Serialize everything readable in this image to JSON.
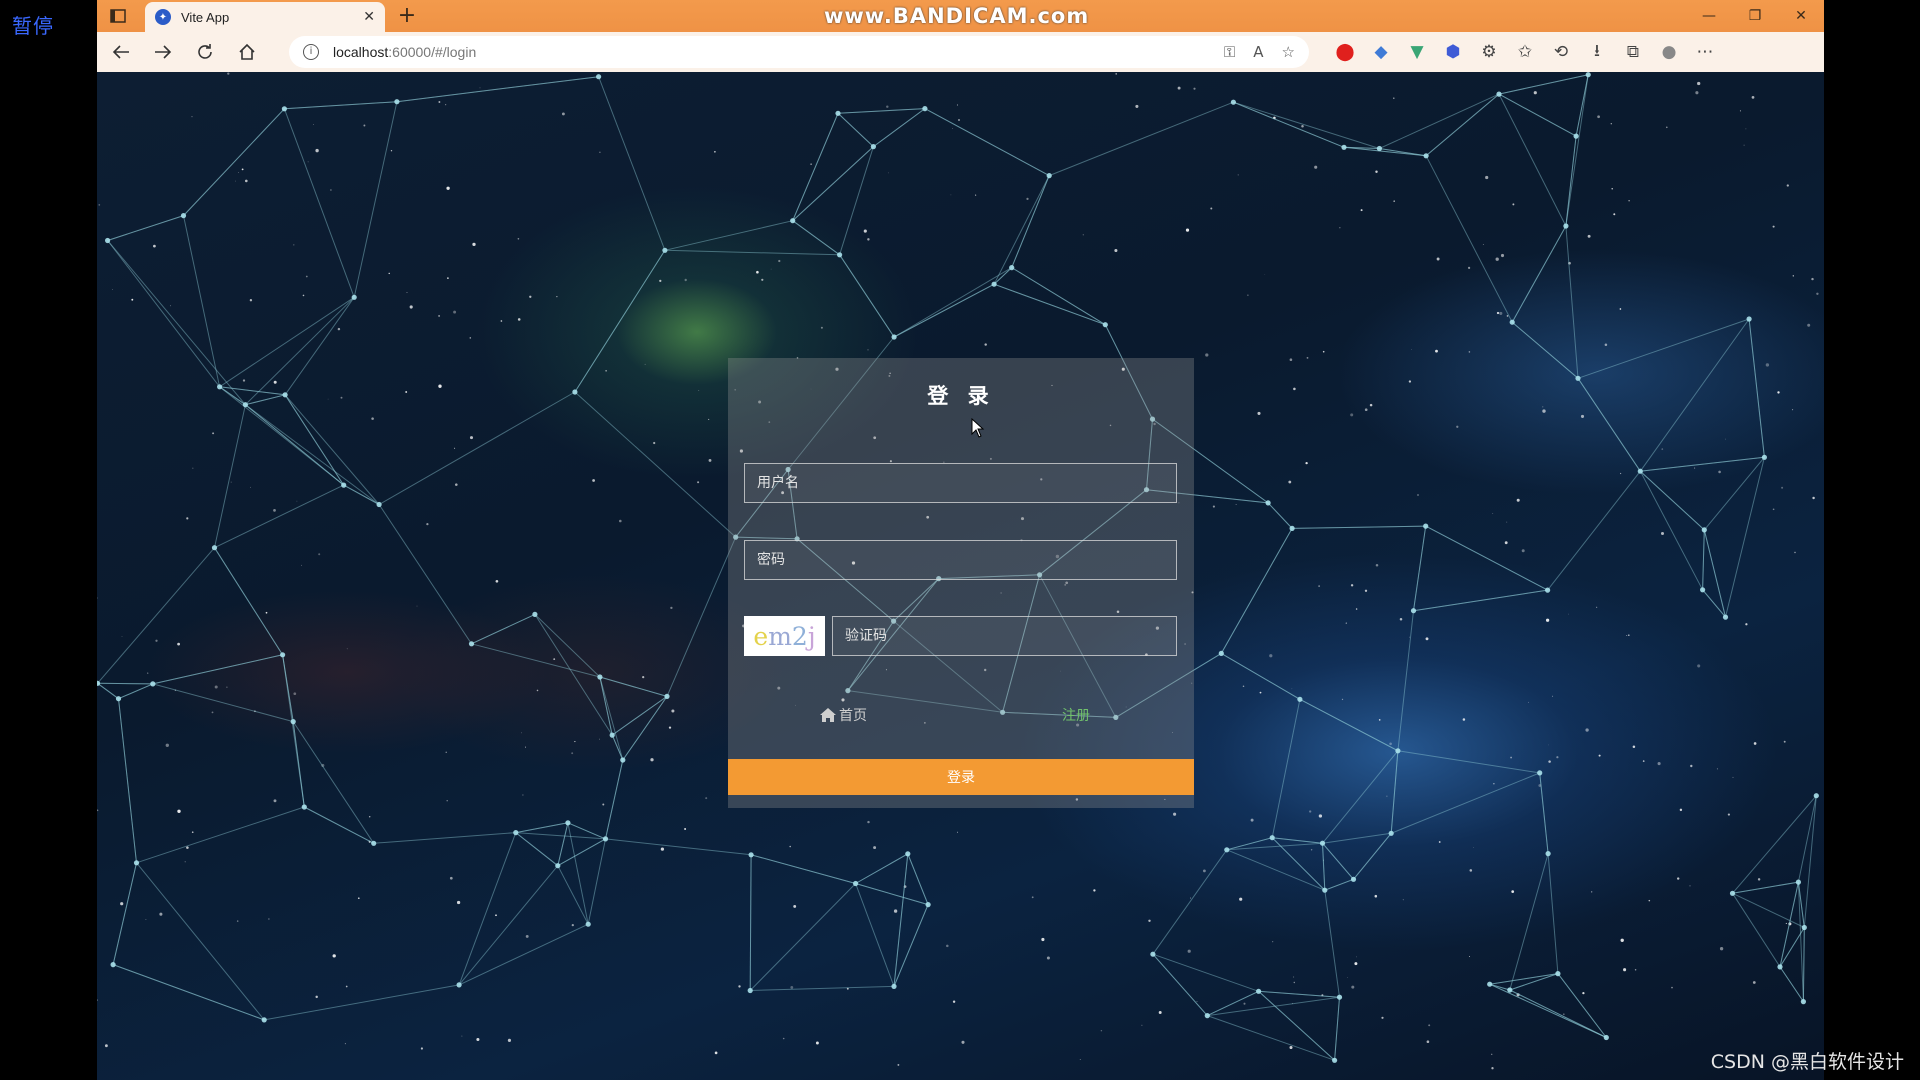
{
  "recording_overlay": {
    "pause_label": "暂停",
    "watermark": "www.BANDICAM.com"
  },
  "browser": {
    "tab": {
      "title": "Vite App",
      "favicon": "vite-favicon-icon",
      "close": "✕"
    },
    "new_tab": "+",
    "url_host": "localhost",
    "url_rest": ":60000/#/login",
    "window_controls": {
      "minimize": "—",
      "restore": "❐",
      "close": "✕"
    }
  },
  "login": {
    "title": "登 录",
    "username_placeholder": "用户名",
    "password_placeholder": "密码",
    "captcha_text": [
      "e",
      "m",
      "2",
      "j"
    ],
    "captcha_placeholder": "验证码",
    "home_link": "首页",
    "register_link": "注册",
    "submit_label": "登录"
  },
  "colors": {
    "accent_orange": "#f39a33",
    "titlebar": "#f09548",
    "register_green": "#71c26c"
  },
  "footer_watermark": "CSDN @黑白软件设计"
}
